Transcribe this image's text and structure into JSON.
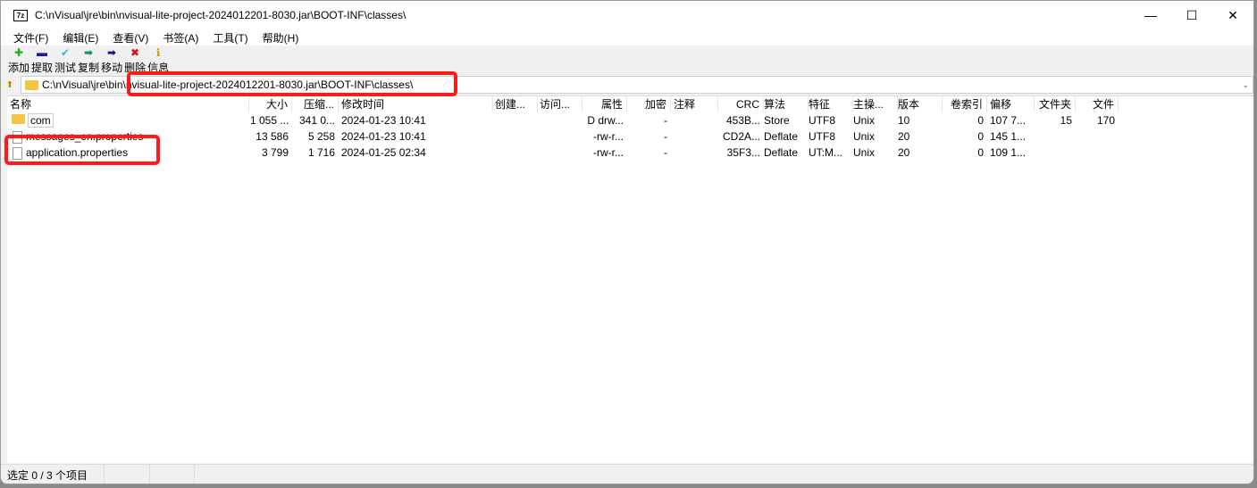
{
  "window": {
    "title": "C:\\nVisual\\jre\\bin\\nvisual-lite-project-2024012201-8030.jar\\BOOT-INF\\classes\\",
    "logo": "7z",
    "minimize": "—",
    "maximize": "☐",
    "close": "✕"
  },
  "menu": [
    "文件(F)",
    "编辑(E)",
    "查看(V)",
    "书签(A)",
    "工具(T)",
    "帮助(H)"
  ],
  "toolbar": [
    {
      "label": "添加",
      "icon": "✚",
      "color": "#1fae1f"
    },
    {
      "label": "提取",
      "icon": "▬",
      "color": "#1a1aa8"
    },
    {
      "label": "测试",
      "icon": "✔",
      "color": "#34b8c8"
    },
    {
      "label": "复制",
      "icon": "➡",
      "color": "#1a8a7a"
    },
    {
      "label": "移动",
      "icon": "➡",
      "color": "#1a1a80"
    },
    {
      "label": "删除",
      "icon": "✖",
      "color": "#d01010"
    },
    {
      "label": "信息",
      "icon": "ℹ",
      "color": "#c0a000"
    }
  ],
  "address": {
    "path": "C:\\nVisual\\jre\\bin\\nvisual-lite-project-2024012201-8030.jar\\BOOT-INF\\classes\\"
  },
  "columns": [
    "名称",
    "大小",
    "压缩...",
    "修改时间",
    "创建...",
    "访问...",
    "属性",
    "加密",
    "注释",
    "CRC",
    "算法",
    "特征",
    "主操...",
    "版本",
    "卷索引",
    "偏移",
    "文件夹",
    "文件"
  ],
  "rows": [
    [
      "com",
      "1 055 ...",
      "341 0...",
      "2024-01-23 10:41",
      "",
      "",
      "D drw...",
      "-",
      "",
      "453B...",
      "Store",
      "UTF8",
      "Unix",
      "10",
      "0",
      "107 7...",
      "15",
      "170"
    ],
    [
      "messages_en.properties",
      "13 586",
      "5 258",
      "2024-01-23 10:41",
      "",
      "",
      "-rw-r...",
      "-",
      "",
      "CD2A...",
      "Deflate",
      "UTF8",
      "Unix",
      "20",
      "0",
      "145 1...",
      "",
      ""
    ],
    [
      "application.properties",
      "3 799",
      "1 716",
      "2024-01-25 02:34",
      "",
      "",
      "-rw-r...",
      "-",
      "",
      "35F3...",
      "Deflate",
      "UT:M...",
      "Unix",
      "20",
      "0",
      "109 1...",
      "",
      ""
    ]
  ],
  "status": {
    "selection": "选定 0 / 3 个项目"
  }
}
